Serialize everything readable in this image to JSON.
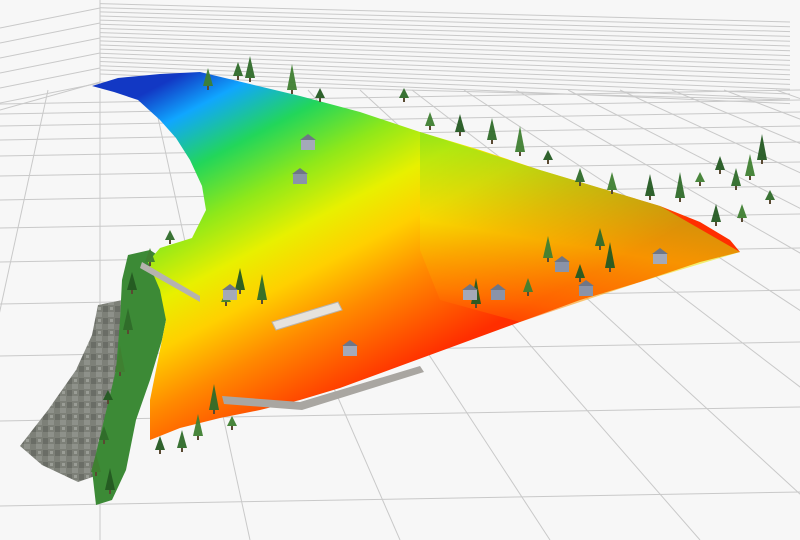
{
  "viewer": {
    "background_color": "#f7f7f7",
    "grid_color": "#c9c9c9",
    "grid_visible": true
  },
  "point_cloud": {
    "render_mode": "elevation-colormap",
    "colormap": [
      "#1030c8",
      "#10c8ff",
      "#30e000",
      "#b0f000",
      "#ffe000",
      "#ff9000",
      "#ff3000"
    ],
    "features": [
      "terrain-surface",
      "trees",
      "buildings",
      "road",
      "riverbank",
      "aerial-imagery-ground"
    ]
  }
}
